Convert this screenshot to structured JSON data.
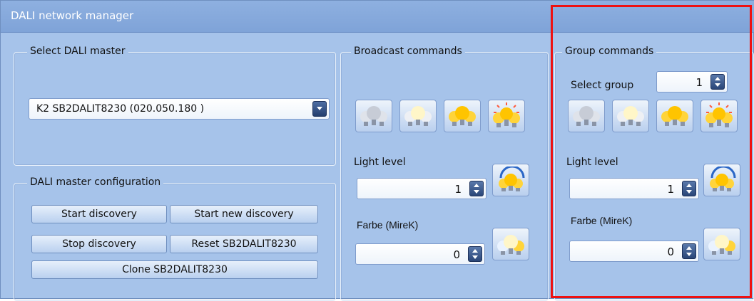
{
  "window": {
    "title": "DALI network manager"
  },
  "select_master": {
    "legend": "Select DALI master",
    "selected": "K2 SB2DALIT8230 (020.050.180 )"
  },
  "master_config": {
    "legend": "DALI master configuration",
    "start_discovery": "Start discovery",
    "start_new_discovery": "Start new discovery",
    "stop_discovery": "Stop discovery",
    "reset": "Reset SB2DALIT8230",
    "clone": "Clone SB2DALIT8230"
  },
  "broadcast": {
    "legend": "Broadcast commands",
    "light_level_label": "Light level",
    "light_level_value": "1",
    "color_label": "Farbe (MireK)",
    "color_value": "0"
  },
  "group": {
    "legend": "Group commands",
    "select_group_label": "Select group",
    "select_group_value": "1",
    "light_level_label": "Light level",
    "light_level_value": "1",
    "color_label": "Farbe (MireK)",
    "color_value": "0"
  },
  "icons": [
    "lamps-off-icon",
    "lamps-dim-icon",
    "lamps-on-icon",
    "lamps-max-icon",
    "lamps-set-level-icon",
    "lamps-set-color-icon"
  ],
  "colors": {
    "highlight": "#ee1111",
    "panel": "#a6c3ea"
  }
}
